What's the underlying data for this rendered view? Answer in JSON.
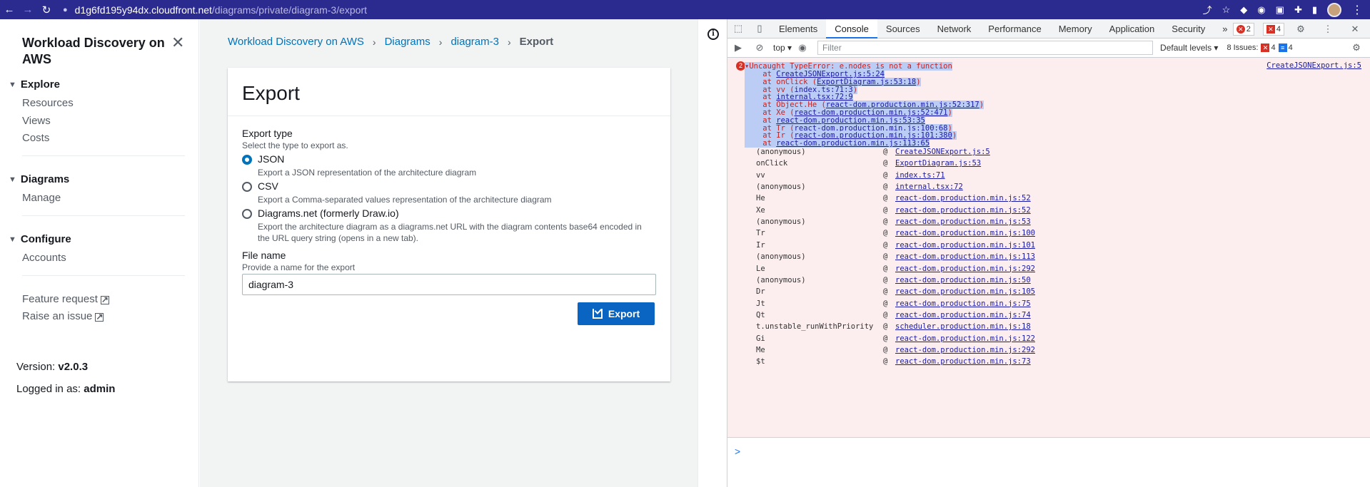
{
  "browser": {
    "back_icon": "←",
    "forward_icon": "→",
    "reload_icon": "↻",
    "host": "d1g6fd195y94dx.cloudfront.net",
    "path": "/diagrams/private/diagram-3/export"
  },
  "sidebar": {
    "title": "Workload Discovery on AWS",
    "sections": [
      {
        "label": "Explore",
        "items": [
          "Resources",
          "Views",
          "Costs"
        ]
      },
      {
        "label": "Diagrams",
        "items": [
          "Manage"
        ]
      },
      {
        "label": "Configure",
        "items": [
          "Accounts"
        ]
      }
    ],
    "external_links": [
      "Feature request",
      "Raise an issue"
    ],
    "version_label": "Version:",
    "version": "v2.0.3",
    "logged_in_label": "Logged in as:",
    "user": "admin"
  },
  "breadcrumb": [
    "Workload Discovery on AWS",
    "Diagrams",
    "diagram-3",
    "Export"
  ],
  "panel": {
    "title": "Export",
    "export_type_label": "Export type",
    "export_type_desc": "Select the type to export as.",
    "options": [
      {
        "label": "JSON",
        "desc": "Export a JSON representation of the architecture diagram",
        "checked": true
      },
      {
        "label": "CSV",
        "desc": "Export a Comma-separated values representation of the architecture diagram",
        "checked": false
      },
      {
        "label": "Diagrams.net (formerly Draw.io)",
        "desc": "Export the architecture diagram as a diagrams.net URL with the diagram contents base64 encoded in the URL query string (opens in a new tab).",
        "checked": false
      }
    ],
    "file_name_label": "File name",
    "file_name_desc": "Provide a name for the export",
    "file_name_value": "diagram-3",
    "export_button": "Export"
  },
  "devtools": {
    "tabs": [
      "Elements",
      "Console",
      "Sources",
      "Network",
      "Performance",
      "Memory",
      "Application",
      "Security"
    ],
    "active_tab": "Console",
    "more": "»",
    "error_count": "2",
    "warning_count": "4",
    "context": "top",
    "filter_placeholder": "Filter",
    "levels": "Default levels",
    "issues_label": "8 Issues:",
    "issues_errors": "4",
    "issues_info": "4",
    "error": {
      "count": "2",
      "message": "Uncaught TypeError: e.nodes is not a function",
      "source": "CreateJSONExport.js:5",
      "stack": [
        {
          "prefix": "    at ",
          "link": "CreateJSONExport.js:5:24",
          "suffix": ""
        },
        {
          "prefix": "    at onClick (",
          "link": "ExportDiagram.js:53:18",
          "suffix": ")"
        },
        {
          "prefix": "    at vv (",
          "link": "index.ts:71:3",
          "suffix": ")"
        },
        {
          "prefix": "    at ",
          "link": "internal.tsx:72:9",
          "suffix": ""
        },
        {
          "prefix": "    at Object.He (",
          "link": "react-dom.production.min.js:52:317",
          "suffix": ")"
        },
        {
          "prefix": "    at Xe (",
          "link": "react-dom.production.min.js:52:471",
          "suffix": ")"
        },
        {
          "prefix": "    at ",
          "link": "react-dom.production.min.js:53:35",
          "suffix": ""
        },
        {
          "prefix": "    at Tr (",
          "link": "react-dom.production.min.js:100:68",
          "suffix": ")"
        },
        {
          "prefix": "    at Ir (",
          "link": "react-dom.production.min.js:101:380",
          "suffix": ")"
        },
        {
          "prefix": "    at ",
          "link": "react-dom.production.min.js:113:65",
          "suffix": ""
        }
      ],
      "frames": [
        {
          "fn": "(anonymous)",
          "file": "CreateJSONExport.js:5"
        },
        {
          "fn": "onClick",
          "file": "ExportDiagram.js:53"
        },
        {
          "fn": "vv",
          "file": "index.ts:71"
        },
        {
          "fn": "(anonymous)",
          "file": "internal.tsx:72"
        },
        {
          "fn": "He",
          "file": "react-dom.production.min.js:52"
        },
        {
          "fn": "Xe",
          "file": "react-dom.production.min.js:52"
        },
        {
          "fn": "(anonymous)",
          "file": "react-dom.production.min.js:53"
        },
        {
          "fn": "Tr",
          "file": "react-dom.production.min.js:100"
        },
        {
          "fn": "Ir",
          "file": "react-dom.production.min.js:101"
        },
        {
          "fn": "(anonymous)",
          "file": "react-dom.production.min.js:113"
        },
        {
          "fn": "Le",
          "file": "react-dom.production.min.js:292"
        },
        {
          "fn": "(anonymous)",
          "file": "react-dom.production.min.js:50"
        },
        {
          "fn": "Dr",
          "file": "react-dom.production.min.js:105"
        },
        {
          "fn": "Jt",
          "file": "react-dom.production.min.js:75"
        },
        {
          "fn": "Qt",
          "file": "react-dom.production.min.js:74"
        },
        {
          "fn": "t.unstable_runWithPriority",
          "file": "scheduler.production.min.js:18"
        },
        {
          "fn": "Gi",
          "file": "react-dom.production.min.js:122"
        },
        {
          "fn": "Me",
          "file": "react-dom.production.min.js:292"
        },
        {
          "fn": "$t",
          "file": "react-dom.production.min.js:73"
        }
      ]
    },
    "prompt": ">"
  }
}
